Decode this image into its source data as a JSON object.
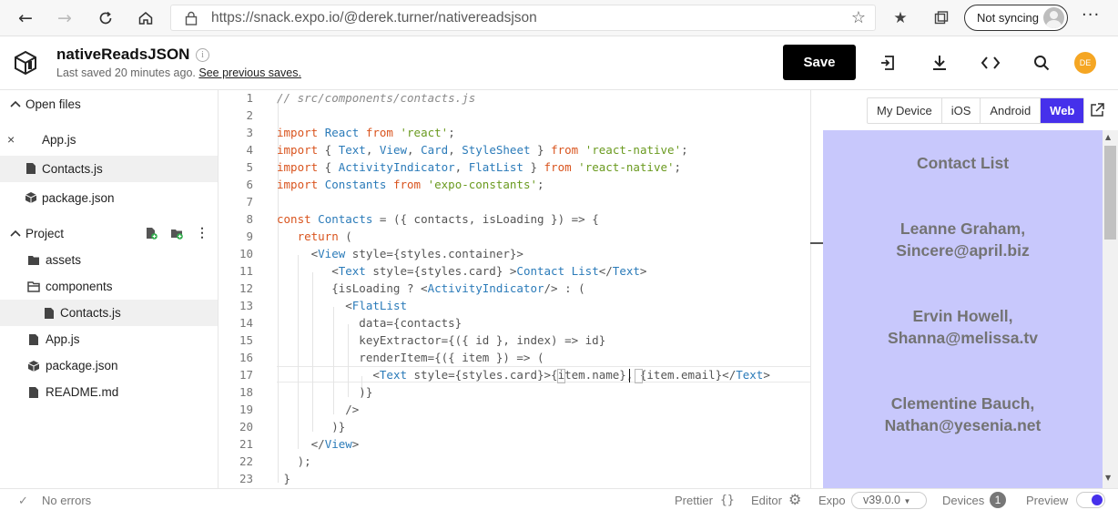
{
  "browser": {
    "url": "https://snack.expo.io/@derek.turner/nativereadsjson",
    "sync_label": "Not syncing"
  },
  "header": {
    "project_name": "nativeReadsJSON",
    "last_saved": "Last saved 20 minutes ago.",
    "see_previous": "See previous saves.",
    "save_label": "Save",
    "avatar_initials": "DE",
    "avatar_color": "#f5a623"
  },
  "sidebar": {
    "open_files_label": "Open files",
    "open_files": [
      {
        "label": "App.js",
        "icon": "close-icon"
      },
      {
        "label": "Contacts.js",
        "icon": "file-icon",
        "active": true
      },
      {
        "label": "package.json",
        "icon": "package-icon"
      }
    ],
    "project_label": "Project",
    "tree": [
      {
        "label": "assets",
        "icon": "folder-icon"
      },
      {
        "label": "components",
        "icon": "folder-open-icon"
      },
      {
        "label": "Contacts.js",
        "icon": "file-icon",
        "active": true
      },
      {
        "label": "App.js",
        "icon": "file-icon"
      },
      {
        "label": "package.json",
        "icon": "package-icon"
      },
      {
        "label": "README.md",
        "icon": "file-icon"
      }
    ]
  },
  "editor": {
    "line_numbers": [
      "1",
      "2",
      "3",
      "4",
      "5",
      "6",
      "7",
      "8",
      "9",
      "10",
      "11",
      "12",
      "13",
      "14",
      "15",
      "16",
      "17",
      "18",
      "19",
      "20",
      "21",
      "22",
      "23"
    ]
  },
  "preview": {
    "tabs": [
      "My Device",
      "iOS",
      "Android",
      "Web"
    ],
    "active_tab": "Web",
    "background_color": "#c8c8fc",
    "cards": [
      "Contact List",
      "Leanne Graham, Sincere@april.biz",
      "Ervin Howell, Shanna@melissa.tv",
      "Clementine Bauch, Nathan@yesenia.net"
    ]
  },
  "status": {
    "errors": "No errors",
    "prettier": "Prettier",
    "editor": "Editor",
    "expo": "Expo",
    "version": "v39.0.0",
    "devices": "Devices",
    "devices_count": "1",
    "preview": "Preview"
  }
}
